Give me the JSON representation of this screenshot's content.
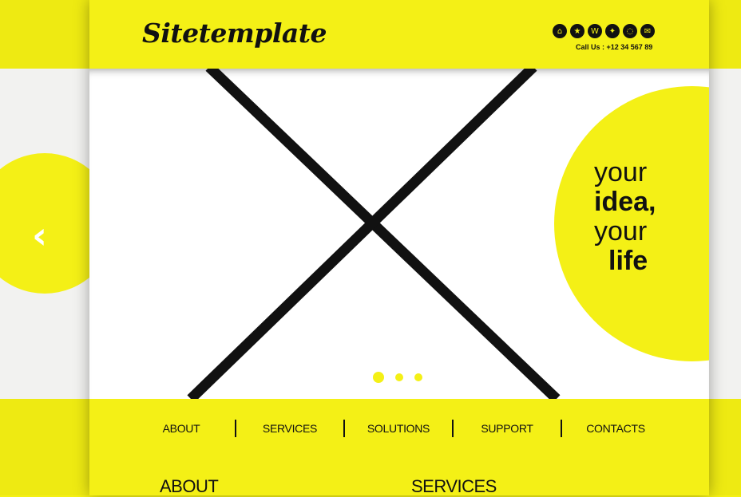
{
  "header": {
    "logo": "Sitetemplate",
    "call_us": "Call Us : +12 34 567 89",
    "social_icons": [
      "home-icon",
      "star-icon",
      "w-icon",
      "share-icon",
      "chat-icon",
      "mail-icon"
    ]
  },
  "hero": {
    "tagline": [
      "your",
      "idea,",
      "your",
      "life"
    ],
    "active_slide": 1,
    "slide_count": 3
  },
  "nav": {
    "items": [
      "ABOUT",
      "SERVICES",
      "SOLUTIONS",
      "SUPPORT",
      "CONTACTS"
    ]
  },
  "sections": {
    "about": "ABOUT",
    "services": "SERVICES"
  },
  "colors": {
    "accent": "#f4f016",
    "text": "#111111",
    "background": "#ffffff"
  }
}
